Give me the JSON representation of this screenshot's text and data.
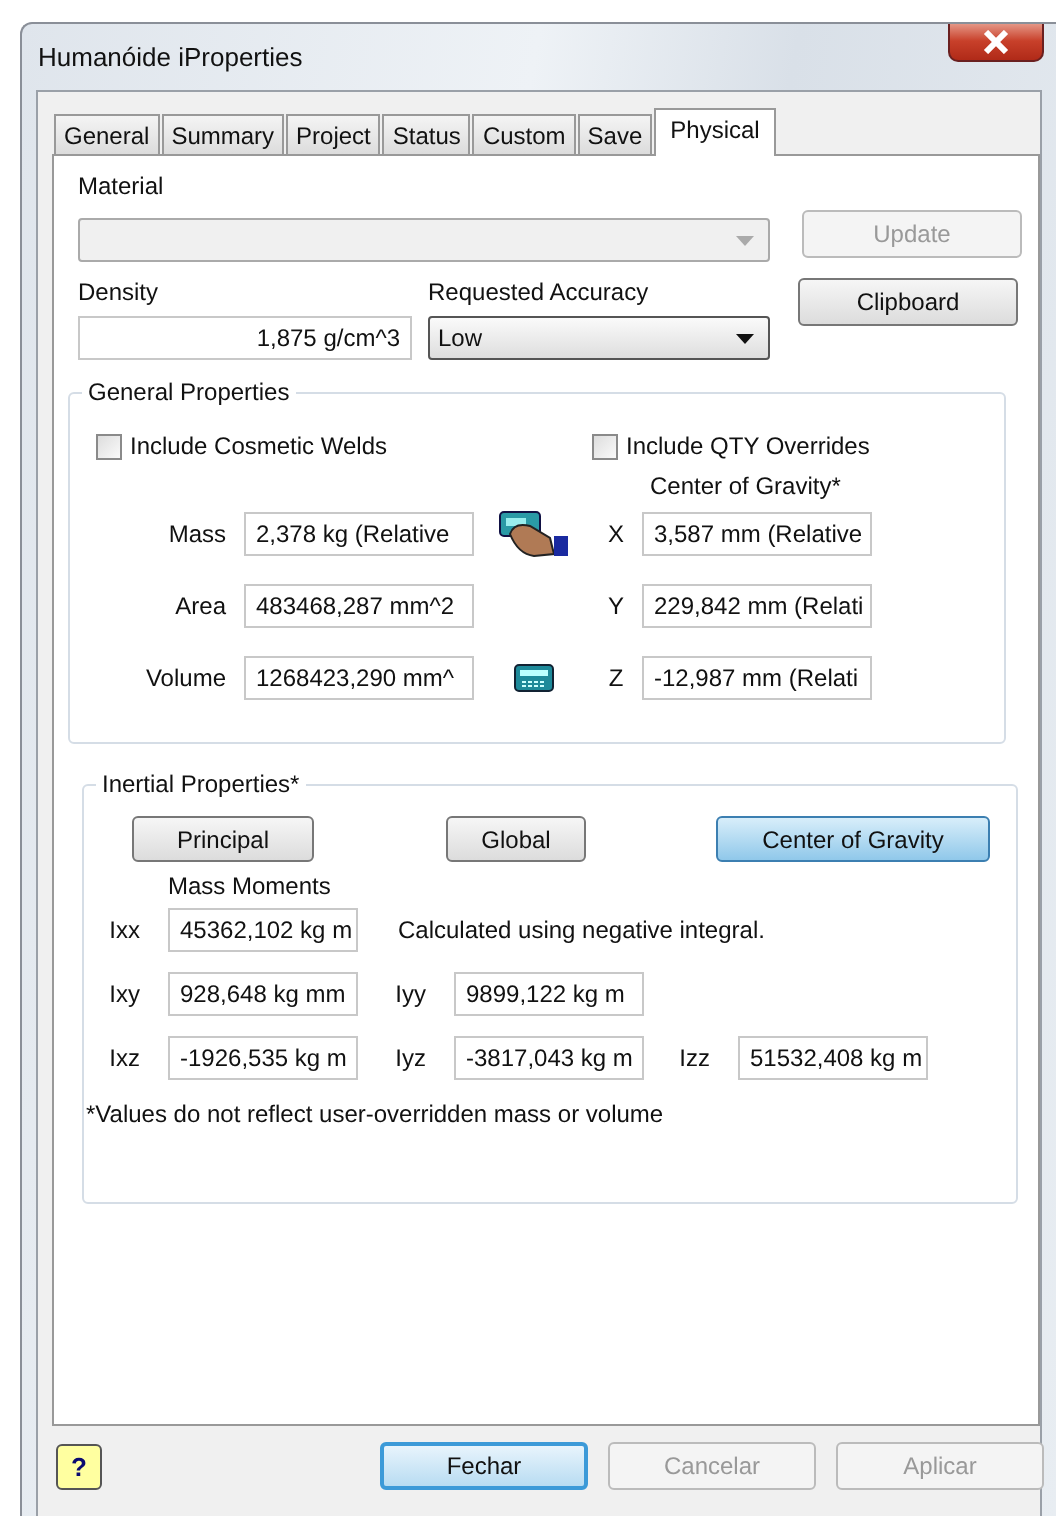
{
  "window": {
    "title": "Humanóide iProperties"
  },
  "tabs": [
    {
      "label": "General",
      "selected": false
    },
    {
      "label": "Summary",
      "selected": false
    },
    {
      "label": "Project",
      "selected": false
    },
    {
      "label": "Status",
      "selected": false
    },
    {
      "label": "Custom",
      "selected": false
    },
    {
      "label": "Save",
      "selected": false
    },
    {
      "label": "Physical",
      "selected": true
    }
  ],
  "material": {
    "label": "Material",
    "disabled": true
  },
  "side_buttons": [
    {
      "label": "Update",
      "disabled": true
    },
    {
      "label": "Clipboard",
      "disabled": false
    }
  ],
  "density": {
    "label": "Density",
    "value": "1,875 g/cm^3"
  },
  "accuracy": {
    "label": "Requested Accuracy",
    "value": "Low"
  },
  "general_properties": {
    "title": "General Properties",
    "checkboxes": [
      {
        "label": "Include Cosmetic Welds",
        "checked": false
      },
      {
        "label": "Include QTY Overrides",
        "checked": false
      }
    ],
    "center_of_gravity_label": "Center of Gravity*",
    "rows": [
      {
        "label": "Mass",
        "value": "2,378 kg (Relative",
        "axis": "X",
        "coordinate": "3,587 mm (Relative"
      },
      {
        "label": "Area",
        "value": "483468,287 mm^2",
        "axis": "Y",
        "coordinate": "229,842 mm (Relati"
      },
      {
        "label": "Volume",
        "value": "1268423,290 mm^",
        "axis": "Z",
        "coordinate": "-12,987 mm (Relati"
      }
    ]
  },
  "inertial_properties": {
    "title": "Inertial Properties*",
    "buttons": [
      {
        "label": "Principal",
        "selected": false
      },
      {
        "label": "Global",
        "selected": false
      },
      {
        "label": "Center of Gravity",
        "selected": true
      }
    ],
    "mass_moments_label": "Mass Moments",
    "message": "Calculated using negative integral.",
    "rows": [
      [
        {
          "label": "Ixx",
          "value": "45362,102 kg m"
        }
      ],
      [
        {
          "label": "Ixy",
          "value": "928,648 kg mm"
        },
        {
          "label": "Iyy",
          "value": "9899,122 kg m"
        }
      ],
      [
        {
          "label": "Ixz",
          "value": "-1926,535 kg m"
        },
        {
          "label": "Iyz",
          "value": "-3817,043 kg m"
        },
        {
          "label": "Izz",
          "value": "51532,408 kg m"
        }
      ]
    ],
    "note": "*Values do not reflect user-overridden mass or volume"
  },
  "footer": {
    "help_label": "?",
    "buttons": [
      {
        "label": "Fechar",
        "default": true,
        "disabled": false
      },
      {
        "label": "Cancelar",
        "default": false,
        "disabled": true
      },
      {
        "label": "Aplicar",
        "default": false,
        "disabled": true
      }
    ]
  }
}
